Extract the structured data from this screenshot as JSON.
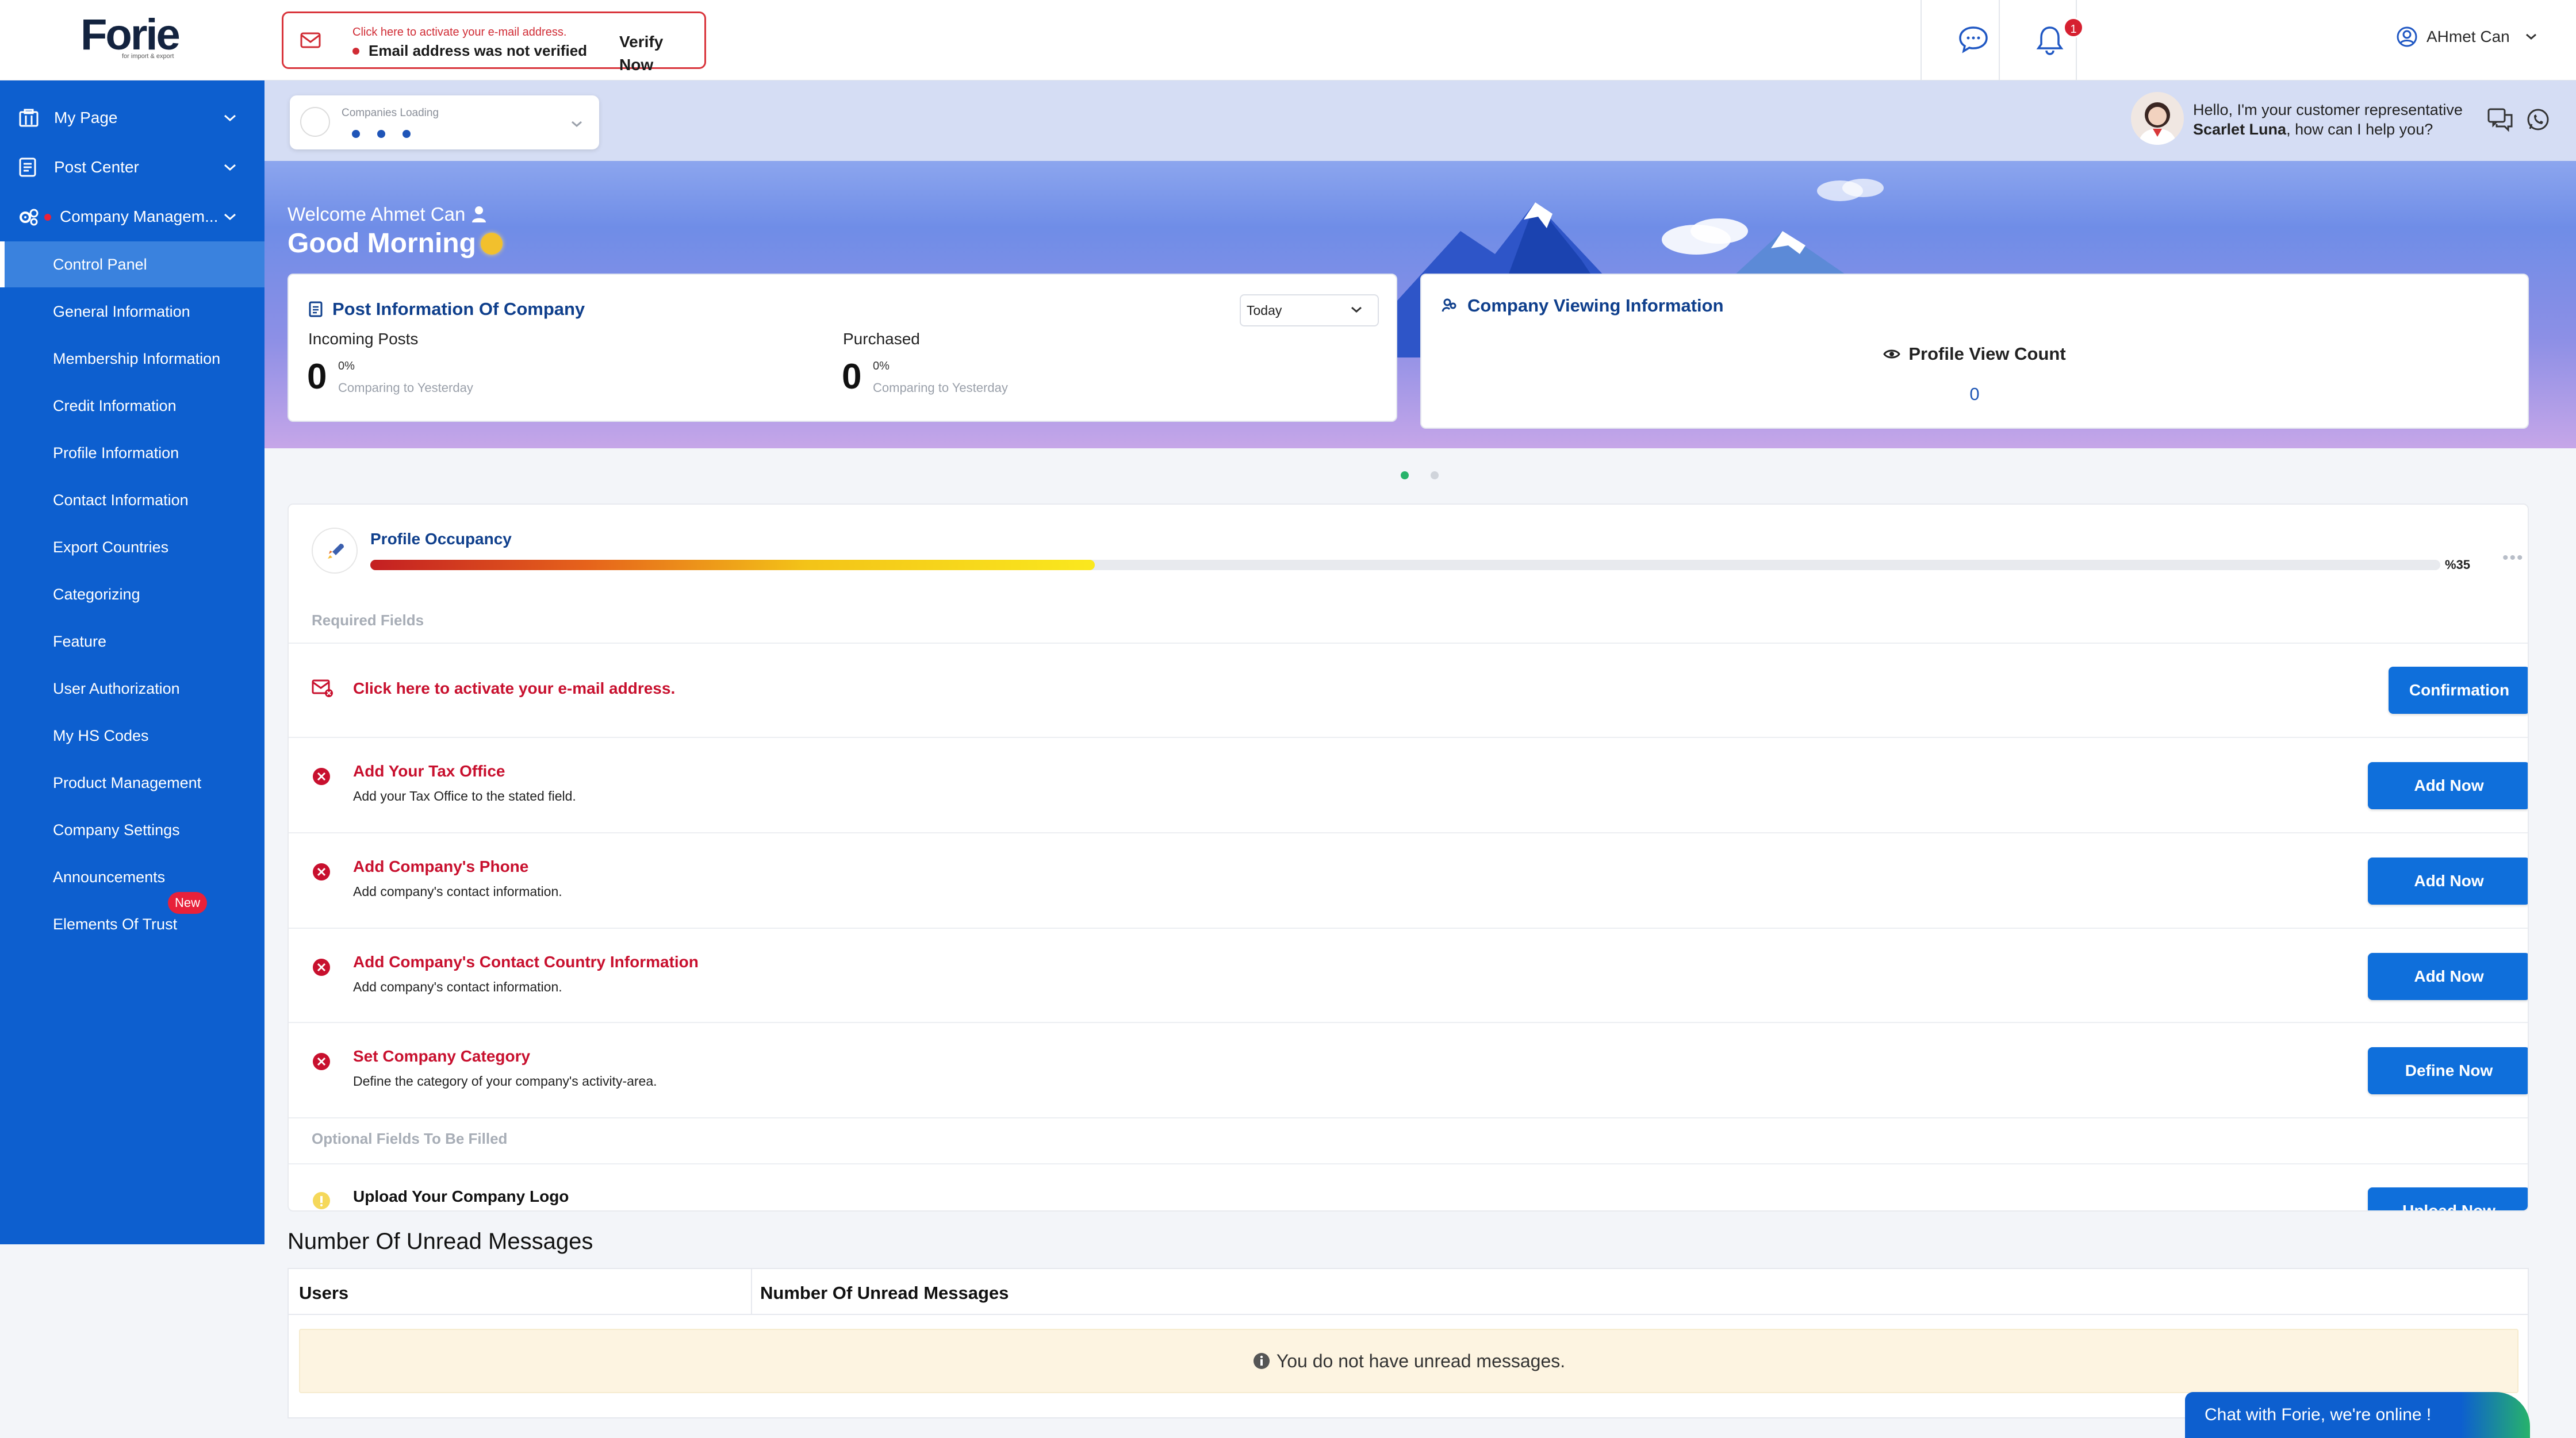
{
  "brand": {
    "logo_text": "Forie",
    "logo_sub": "for import & export"
  },
  "verify": {
    "hint": "Click here to activate your e-mail address.",
    "message": "Email address was not verified",
    "button": "Verify Now"
  },
  "header": {
    "notification_count": "1",
    "user_name": "AHmet Can"
  },
  "company_selector": {
    "label": "Companies Loading"
  },
  "support": {
    "line1": "Hello, I'm your customer representative",
    "name": "Scarlet Luna",
    "line2_rest": ", how can I help you?"
  },
  "sidebar": {
    "top": [
      {
        "label": "My Page",
        "icon": "building-icon"
      },
      {
        "label": "Post Center",
        "icon": "document-icon"
      },
      {
        "label": "Company Managem...",
        "icon": "gears-icon"
      }
    ],
    "items": [
      {
        "label": "Control Panel",
        "active": true
      },
      {
        "label": "General Information"
      },
      {
        "label": "Membership Information"
      },
      {
        "label": "Credit Information"
      },
      {
        "label": "Profile Information"
      },
      {
        "label": "Contact Information"
      },
      {
        "label": "Export Countries"
      },
      {
        "label": "Categorizing"
      },
      {
        "label": "Feature"
      },
      {
        "label": "User Authorization"
      },
      {
        "label": "My HS Codes"
      },
      {
        "label": "Product Management"
      },
      {
        "label": "Company Settings"
      },
      {
        "label": "Announcements"
      },
      {
        "label": "Elements Of Trust"
      }
    ],
    "new_badge": "New"
  },
  "welcome": {
    "text": "Welcome Ahmet Can",
    "greeting": "Good Morning"
  },
  "post_info": {
    "title": "Post Information Of Company",
    "range": "Today",
    "incoming_label": "Incoming Posts",
    "incoming_value": "0",
    "incoming_pct": "0%",
    "incoming_cmp": "Comparing to Yesterday",
    "purchased_label": "Purchased",
    "purchased_value": "0",
    "purchased_pct": "0%",
    "purchased_cmp": "Comparing to Yesterday"
  },
  "viewing": {
    "title": "Company Viewing Information",
    "pv_label": "Profile View Count",
    "pv_value": "0"
  },
  "occupancy": {
    "title": "Profile Occupancy",
    "percent": 35,
    "percent_label": "%35",
    "required_label": "Required Fields",
    "optional_label": "Optional Fields To Be Filled",
    "email_row": {
      "title": "Click here to activate your e-mail address.",
      "button": "Confirmation"
    },
    "rows": [
      {
        "title": "Add Your Tax Office",
        "desc": "Add your Tax Office to the stated field.",
        "button": "Add Now"
      },
      {
        "title": "Add Company's Phone",
        "desc": "Add company's contact information.",
        "button": "Add Now"
      },
      {
        "title": "Add Company's Contact Country Information",
        "desc": "Add company's contact information.",
        "button": "Add Now"
      },
      {
        "title": "Set Company Category",
        "desc": "Define the category of your company's activity-area.",
        "button": "Define Now"
      }
    ],
    "optional_row": {
      "title": "Upload Your Company Logo",
      "button": "Upload Now"
    }
  },
  "unread": {
    "title": "Number Of Unread Messages",
    "col_users": "Users",
    "col_count": "Number Of Unread Messages",
    "empty": "You do not have unread messages."
  },
  "chat_widget": {
    "text": "Chat with Forie, we're online !"
  },
  "colors": {
    "primary": "#0d5fcf",
    "error": "#c8102e",
    "accent_green": "#27b36b"
  }
}
